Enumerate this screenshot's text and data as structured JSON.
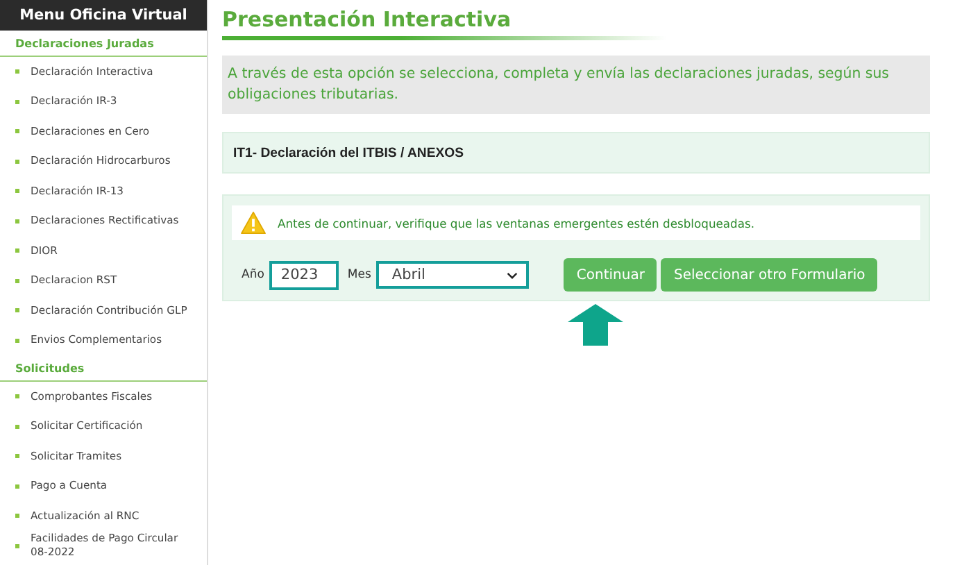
{
  "sidebar": {
    "title": "Menu Oficina Virtual",
    "sections": [
      {
        "heading": "Declaraciones Juradas",
        "items": [
          "Declaración Interactiva",
          "Declaración IR-3",
          "Declaraciones en Cero",
          "Declaración Hidrocarburos",
          "Declaración IR-13",
          "Declaraciones Rectificativas",
          "DIOR",
          "Declaracion RST",
          "Declaración Contribución GLP",
          "Envios Complementarios"
        ]
      },
      {
        "heading": "Solicitudes",
        "items": [
          "Comprobantes Fiscales",
          "Solicitar Certificación",
          "Solicitar Tramites",
          "Pago a Cuenta",
          "Actualización al RNC",
          "Facilidades de Pago Circular 08-2022"
        ]
      }
    ]
  },
  "main": {
    "title": "Presentación Interactiva",
    "description": "A través de esta opción se selecciona, completa y envía las declaraciones juradas, según sus obligaciones tributarias.",
    "form_name": "IT1- Declaración del ITBIS / ANEXOS",
    "warning": "Antes de continuar, verifique que las ventanas emergentes estén desbloqueadas.",
    "year_label": "Año",
    "year": "2023",
    "month_label": "Mes",
    "month": "Abril",
    "buttons": [
      "Continuar",
      "Seleccionar otro Formulario"
    ]
  }
}
